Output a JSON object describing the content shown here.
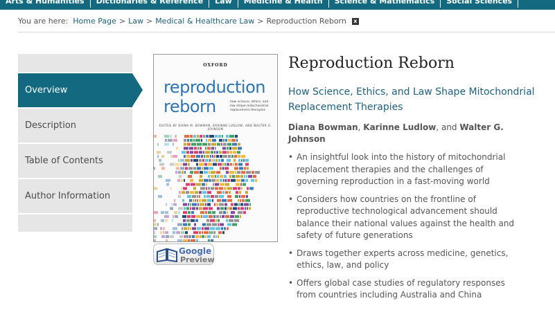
{
  "top_nav": {
    "items": [
      "Arts & Humanities",
      "Dictionaries & Reference",
      "Law",
      "Medicine & Health",
      "Science & Mathematics",
      "Social Sciences"
    ]
  },
  "breadcrumb": {
    "prefix": "You are here:",
    "links": [
      "Home Page",
      "Law",
      "Medical & Healthcare Law"
    ],
    "current": "Reproduction Reborn",
    "close_glyph": "x"
  },
  "side_nav": {
    "items": [
      {
        "label": "Overview",
        "active": true
      },
      {
        "label": "Description",
        "active": false
      },
      {
        "label": "Table of Contents",
        "active": false
      },
      {
        "label": "Author Information",
        "active": false
      }
    ]
  },
  "cover": {
    "publisher": "OXFORD",
    "title_line1": "reproduction",
    "title_line2": "reborn",
    "subtitle": "how science, ethics, and law shape mitochondrial replacement therapies",
    "editors": "EDITED BY DIANA M. BOWMAN, KARINNE LUDLOW, AND WALTER G. JOHNSON",
    "title_color": "#2f73b3"
  },
  "google_preview": {
    "google": "Google",
    "label": "Preview"
  },
  "book": {
    "title": "Reproduction Reborn",
    "subtitle": "How Science, Ethics, and Law Shape Mitochondrial Replacement Therapies",
    "authors": {
      "author1": "Diana Bowman",
      "sep1": ", ",
      "author2": "Karinne Ludlow",
      "sep2": ", and ",
      "author3": "Walter G. Johnson"
    },
    "highlights": [
      "An insightful look into the history of mitochondrial replacement therapies and the challenges of governing reproduction in a fast-moving world",
      "Considers how countries on the frontline of reproductive technological advancement should balance their national values against the health and safety of future generations",
      "Draws together experts across medicine, genetics, ethics, law, and policy",
      "Offers global case studies of regulatory responses from countries including Australia and China"
    ]
  },
  "colors": {
    "nav_teal": "#13697f",
    "link_blue": "#1f5f7a",
    "side_gray": "#e6e6e6"
  },
  "icons": {
    "close": "close-icon",
    "book": "open-book-icon"
  }
}
